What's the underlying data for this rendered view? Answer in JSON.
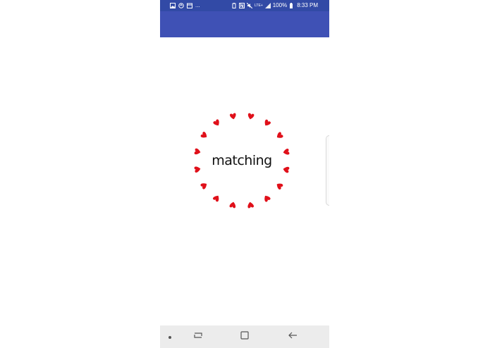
{
  "status_bar": {
    "left_icons": [
      "gallery-icon",
      "sync-icon",
      "calendar-icon"
    ],
    "overflow": "...",
    "right_icons": [
      "battery-saver-icon",
      "nfc-icon",
      "mute-icon",
      "lte-icon",
      "signal-icon"
    ],
    "battery": "100%",
    "time": "8:33 PM",
    "lte_label": "LTE+"
  },
  "loader": {
    "text": "matching",
    "heart_count": 16,
    "heart_color": "#e0101a"
  },
  "nav_bar": {
    "items": [
      "dot-icon",
      "recent-apps-icon",
      "home-icon",
      "back-icon"
    ]
  },
  "colors": {
    "app_bar": "#3f51b5",
    "status_bar": "#324aa6"
  }
}
